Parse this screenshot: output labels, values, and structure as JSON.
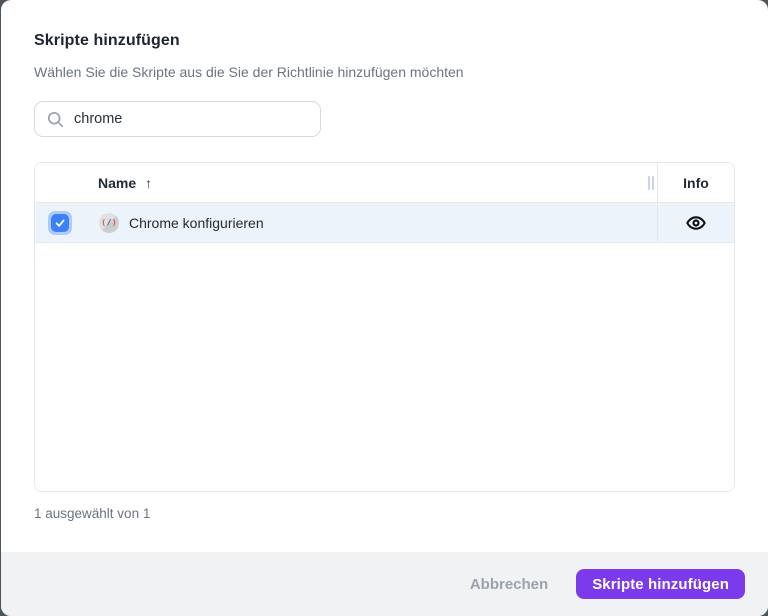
{
  "dialog": {
    "title": "Skripte hinzufügen",
    "subtitle": "Wählen Sie die Skripte aus die Sie der Richtlinie hinzufügen möchten"
  },
  "search": {
    "value": "chrome",
    "icon": "magnifier"
  },
  "table": {
    "columns": {
      "name": "Name",
      "info": "Info"
    },
    "sort": {
      "column": "Name",
      "direction": "asc",
      "icon": "↑"
    },
    "rows": [
      {
        "name": "Chrome konfigurieren",
        "selected": true,
        "icon": "script-icon",
        "info_action": "view-details-eye"
      }
    ]
  },
  "summary": "1 ausgewählt von 1",
  "footer": {
    "cancel_label": "Abbrechen",
    "submit_label": "Skripte hinzufügen"
  },
  "colors": {
    "accent_purple": "#7c3aed",
    "checkbox_blue": "#3b82f6",
    "selected_row_bg": "#edf3fb",
    "footer_bg": "#f0f2f4"
  }
}
